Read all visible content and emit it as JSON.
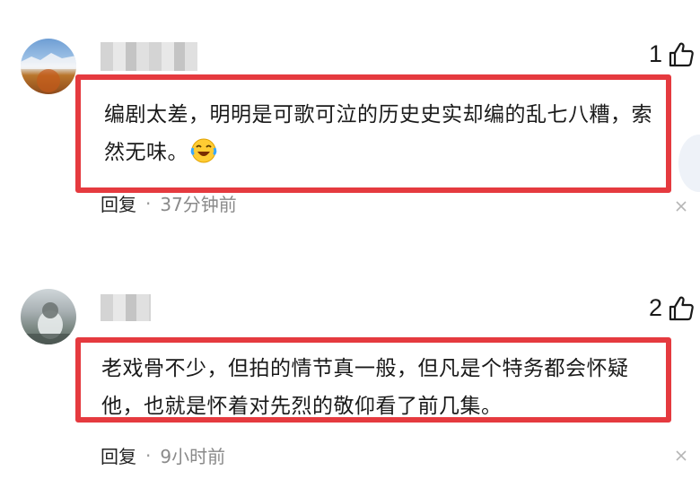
{
  "comments": [
    {
      "like_count": "1",
      "text": "编剧太差，明明是可歌可泣的历史史实却编的乱七八糟，索然无味。",
      "reply_label": "回复",
      "separator": "·",
      "time": "37分钟前"
    },
    {
      "like_count": "2",
      "text": "老戏骨不少，但拍的情节真一般，但凡是个特务都会怀疑他，也就是怀着对先烈的敬仰看了前几集。",
      "reply_label": "回复",
      "separator": "·",
      "time": "9小时前"
    }
  ],
  "icons": {
    "like": "thumbs-up-outline",
    "emoji": "laughing-crying-face",
    "close": "close-x"
  },
  "colors": {
    "highlight_border": "#e53a3f",
    "meta_text": "#8a8a8a"
  }
}
